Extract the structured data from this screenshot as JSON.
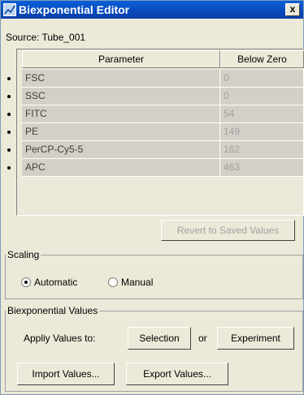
{
  "window": {
    "title": "Biexponential Editor",
    "close_glyph": "x"
  },
  "source": {
    "label": "Source:  Tube_001"
  },
  "table": {
    "headers": {
      "parameter": "Parameter",
      "below_zero": "Below Zero"
    },
    "rows": [
      {
        "parameter": "FSC",
        "below_zero": "0"
      },
      {
        "parameter": "SSC",
        "below_zero": "0"
      },
      {
        "parameter": "FITC",
        "below_zero": "54"
      },
      {
        "parameter": "PE",
        "below_zero": "149"
      },
      {
        "parameter": "PerCP-Cy5-5",
        "below_zero": "162"
      },
      {
        "parameter": "APC",
        "below_zero": "463"
      }
    ]
  },
  "buttons": {
    "revert": "Revert to Saved Values",
    "selection": "Selection",
    "experiment": "Experiment",
    "import": "Import Values...",
    "export": "Export Values..."
  },
  "scaling": {
    "legend": "Scaling",
    "automatic": "Automatic",
    "manual": "Manual",
    "selected": "Automatic"
  },
  "biexp": {
    "legend": "Biexponential Values",
    "apply_label": "Appliy Values to:",
    "or_label": "or"
  },
  "colors": {
    "titlebar": "#0a5fd8",
    "dialog_bg": "#ece9d8",
    "cell_bg": "#d4d0c8"
  }
}
